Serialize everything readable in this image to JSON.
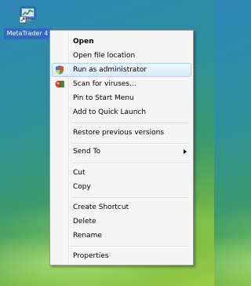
{
  "desktop": {
    "icon_label": "MetaTrader 4"
  },
  "context_menu": {
    "items": [
      {
        "label": "Open"
      },
      {
        "label": "Open file location"
      },
      {
        "label": "Run as administrator",
        "icon": "shield-icon"
      },
      {
        "label": "Scan for viruses...",
        "icon": "antivirus-icon"
      },
      {
        "label": "Pin to Start Menu"
      },
      {
        "label": "Add to Quick Launch"
      },
      {
        "label": "Restore previous versions"
      },
      {
        "label": "Send To"
      },
      {
        "label": "Cut"
      },
      {
        "label": "Copy"
      },
      {
        "label": "Create Shortcut"
      },
      {
        "label": "Delete"
      },
      {
        "label": "Rename"
      },
      {
        "label": "Properties"
      }
    ]
  },
  "colors": {
    "selection_label_bg": "#3168c2",
    "menu_bg": "#f5f5f5",
    "highlight_border": "#a9d1f0"
  }
}
